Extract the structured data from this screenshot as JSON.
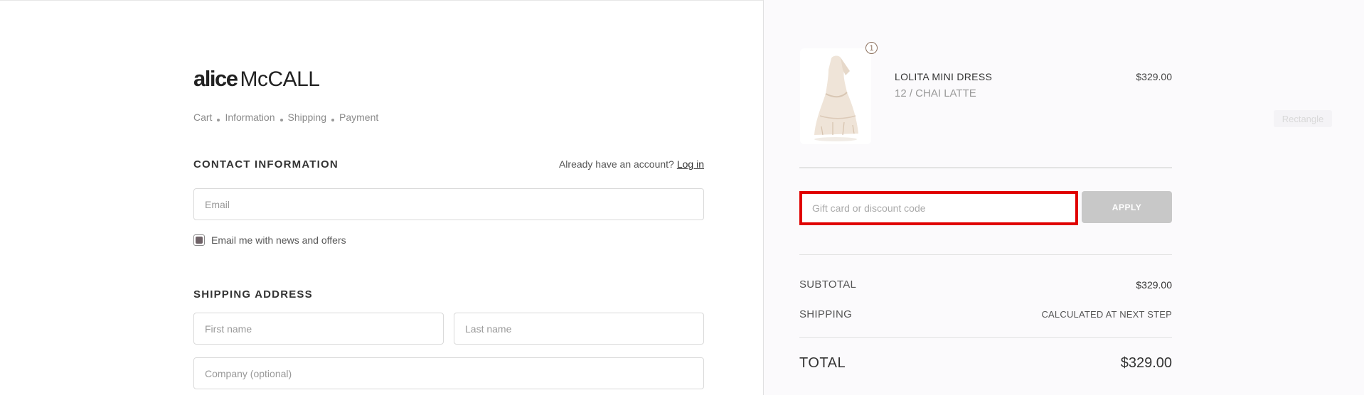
{
  "brand": {
    "part1": "alice",
    "part2": "McCALL"
  },
  "breadcrumb": [
    "Cart",
    "Information",
    "Shipping",
    "Payment"
  ],
  "contact": {
    "title": "CONTACT INFORMATION",
    "account_prompt": "Already have an account?",
    "login_label": "Log in",
    "email_placeholder": "Email",
    "newsletter_label": "Email me with news and offers",
    "newsletter_checked": true
  },
  "shipping": {
    "title": "SHIPPING ADDRESS",
    "first_name_placeholder": "First name",
    "last_name_placeholder": "Last name",
    "company_placeholder": "Company (optional)"
  },
  "order": {
    "item": {
      "name": "LOLITA MINI DRESS",
      "variant": "12 / CHAI LATTE",
      "price": "$329.00",
      "quantity": "1"
    },
    "ghost_label": "Rectangle",
    "discount_placeholder": "Gift card or discount code",
    "apply_label": "APPLY",
    "subtotal_label": "SUBTOTAL",
    "subtotal_value": "$329.00",
    "shipping_label": "SHIPPING",
    "shipping_value": "CALCULATED AT NEXT STEP",
    "total_label": "TOTAL",
    "total_value": "$329.00"
  },
  "colors": {
    "highlight": "#e00000",
    "accent": "#8b6f5c",
    "apply_disabled": "#c8c8c8"
  }
}
